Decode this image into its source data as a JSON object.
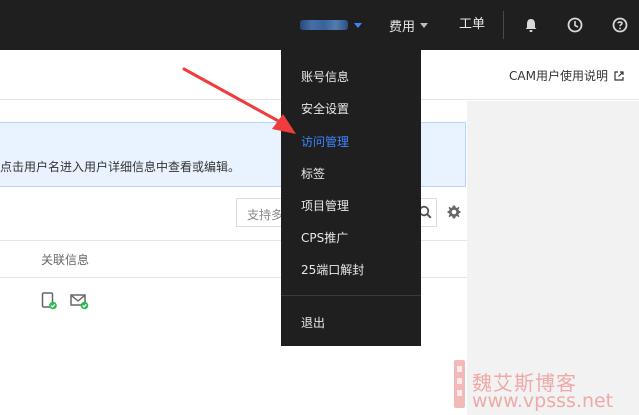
{
  "topbar": {
    "account_icon": "blurred-account-name",
    "fee_label": "费用",
    "ticket_label": "工单",
    "icons": [
      "bell-icon",
      "clock-icon",
      "help-icon"
    ],
    "accent_color": "#3b86ff"
  },
  "header": {
    "doc_link": "CAM用户使用说明"
  },
  "info_banner": {
    "text": "点击用户名进入用户详细信息中查看或编辑。"
  },
  "toolbar": {
    "search_placeholder": "支持多"
  },
  "table": {
    "columns": [
      "关联信息"
    ],
    "rows": [
      {
        "linked_icons": [
          "phone-verified-icon",
          "mail-verified-icon"
        ]
      }
    ]
  },
  "dropdown": {
    "items": [
      {
        "label": "账号信息"
      },
      {
        "label": "安全设置"
      },
      {
        "label": "访问管理",
        "active": true
      },
      {
        "label": "标签"
      },
      {
        "label": "项目管理"
      },
      {
        "label": "CPS推广"
      },
      {
        "label": "25端口解封"
      }
    ],
    "logout": "退出"
  },
  "watermark": {
    "cn": "魏艾斯博客",
    "en": "www.vpsss.net"
  }
}
